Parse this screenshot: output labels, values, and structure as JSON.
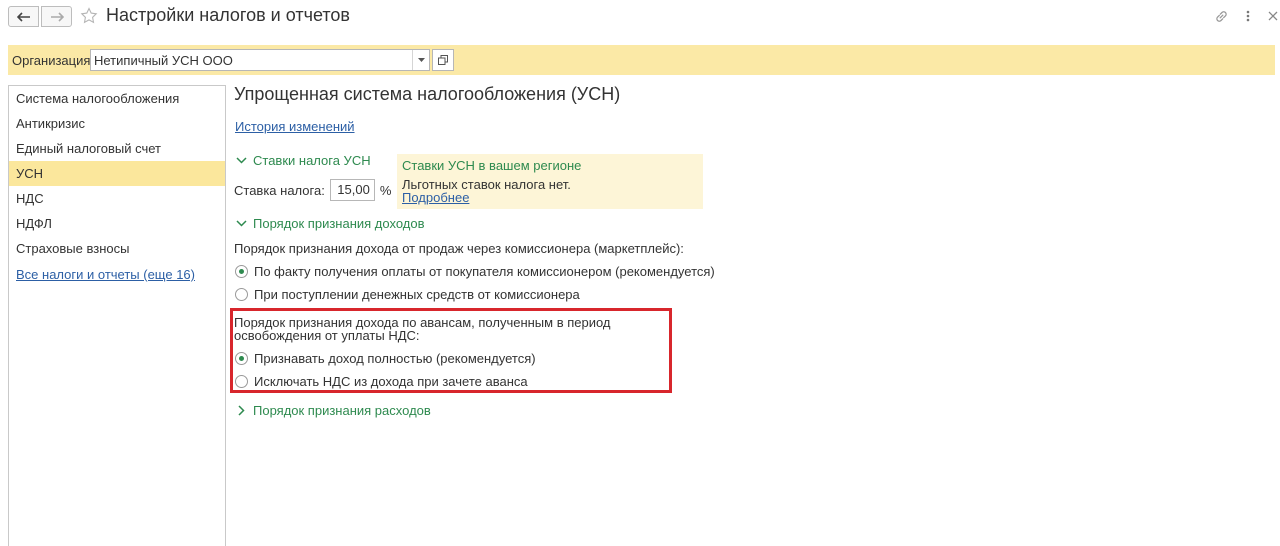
{
  "window": {
    "title": "Настройки налогов и отчетов"
  },
  "organization": {
    "label": "Организация:",
    "value": "Нетипичный УСН ООО"
  },
  "sidebar": {
    "items": [
      {
        "label": "Система налогообложения"
      },
      {
        "label": "Антикризис"
      },
      {
        "label": "Единый налоговый счет"
      },
      {
        "label": "УСН",
        "active": true
      },
      {
        "label": "НДС"
      },
      {
        "label": "НДФЛ"
      },
      {
        "label": "Страховые взносы"
      }
    ],
    "all_taxes_link": "Все налоги и отчеты (еще 16)"
  },
  "main": {
    "heading": "Упрощенная система налогообложения (УСН)",
    "history_link": "История изменений",
    "rates_section": {
      "title": "Ставки налога УСН",
      "rate_label": "Ставка налога:",
      "rate_value": "15,00",
      "rate_unit": "%"
    },
    "info_box": {
      "title": "Ставки УСН в вашем регионе",
      "text": "Льготных ставок налога нет.",
      "link": "Подробнее"
    },
    "income_section": {
      "title": "Порядок признания доходов",
      "commission_label": "Порядок признания дохода от продаж через комиссионера (маркетплейс):",
      "commission_options": [
        {
          "label": "По факту получения оплаты от покупателя комиссионером (рекомендуется)",
          "selected": true
        },
        {
          "label": "При поступлении денежных средств от комиссионера",
          "selected": false
        }
      ],
      "advance_label": "Порядок признания дохода по авансам, полученным в период освобождения от уплаты НДС:",
      "advance_options": [
        {
          "label": "Признавать доход полностью (рекомендуется)",
          "selected": true
        },
        {
          "label": "Исключать НДС из дохода при зачете аванса",
          "selected": false
        }
      ]
    },
    "expenses_section": {
      "title": "Порядок признания расходов"
    }
  },
  "colors": {
    "accent_green": "#2e8a4f",
    "link_blue": "#2c5fa5",
    "org_bar_yellow": "#fbe9a6",
    "active_item_yellow": "#fbe79c",
    "highlight_red": "#d8262c"
  },
  "icons": [
    "arrow-left-icon",
    "arrow-right-icon",
    "star-icon",
    "link-icon",
    "more-vertical-icon",
    "close-icon",
    "chevron-down-icon",
    "open-window-icon",
    "chevron-right-icon"
  ]
}
